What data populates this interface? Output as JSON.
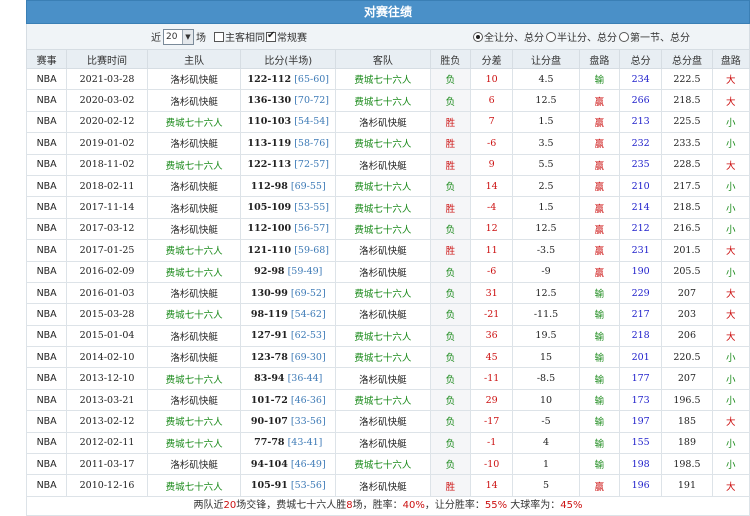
{
  "title": "对赛往绩",
  "filter": {
    "recent_prefix": "近",
    "recent_value": "20",
    "recent_suffix": "场",
    "home_same_label": "主客相同",
    "regular_label": "常规赛",
    "opt1": "全让分、总分",
    "opt2": "半让分、总分",
    "opt3": "第一节、总分"
  },
  "columns": [
    "赛事",
    "比赛时间",
    "主队",
    "比分(半场)",
    "客队",
    "胜负",
    "分差",
    "让分盘",
    "盘路",
    "总分",
    "总分盘",
    "盘路"
  ],
  "rows": [
    {
      "league": "NBA",
      "date": "2021-03-28",
      "home": "洛杉矶快艇",
      "home_g": false,
      "score": "122-112",
      "half": "[65-60]",
      "away": "费城七十六人",
      "away_g": true,
      "wl": "负",
      "diff": "10",
      "handicap": "4.5",
      "hres": "输",
      "total": "234",
      "tline": "222.5",
      "tres": "大"
    },
    {
      "league": "NBA",
      "date": "2020-03-02",
      "home": "洛杉矶快艇",
      "home_g": false,
      "score": "136-130",
      "half": "[70-72]",
      "away": "费城七十六人",
      "away_g": true,
      "wl": "负",
      "diff": "6",
      "handicap": "12.5",
      "hres": "赢",
      "total": "266",
      "tline": "218.5",
      "tres": "大"
    },
    {
      "league": "NBA",
      "date": "2020-02-12",
      "home": "费城七十六人",
      "home_g": true,
      "score": "110-103",
      "half": "[54-54]",
      "away": "洛杉矶快艇",
      "away_g": false,
      "wl": "胜",
      "diff": "7",
      "handicap": "1.5",
      "hres": "赢",
      "total": "213",
      "tline": "225.5",
      "tres": "小"
    },
    {
      "league": "NBA",
      "date": "2019-01-02",
      "home": "洛杉矶快艇",
      "home_g": false,
      "score": "113-119",
      "half": "[58-76]",
      "away": "费城七十六人",
      "away_g": true,
      "wl": "胜",
      "diff": "-6",
      "handicap": "3.5",
      "hres": "赢",
      "total": "232",
      "tline": "233.5",
      "tres": "小"
    },
    {
      "league": "NBA",
      "date": "2018-11-02",
      "home": "费城七十六人",
      "home_g": true,
      "score": "122-113",
      "half": "[72-57]",
      "away": "洛杉矶快艇",
      "away_g": false,
      "wl": "胜",
      "diff": "9",
      "handicap": "5.5",
      "hres": "赢",
      "total": "235",
      "tline": "228.5",
      "tres": "大"
    },
    {
      "league": "NBA",
      "date": "2018-02-11",
      "home": "洛杉矶快艇",
      "home_g": false,
      "score": "112-98",
      "half": "[69-55]",
      "away": "费城七十六人",
      "away_g": true,
      "wl": "负",
      "diff": "14",
      "handicap": "2.5",
      "hres": "赢",
      "total": "210",
      "tline": "217.5",
      "tres": "小"
    },
    {
      "league": "NBA",
      "date": "2017-11-14",
      "home": "洛杉矶快艇",
      "home_g": false,
      "score": "105-109",
      "half": "[53-55]",
      "away": "费城七十六人",
      "away_g": true,
      "wl": "胜",
      "diff": "-4",
      "handicap": "1.5",
      "hres": "赢",
      "total": "214",
      "tline": "218.5",
      "tres": "小"
    },
    {
      "league": "NBA",
      "date": "2017-03-12",
      "home": "洛杉矶快艇",
      "home_g": false,
      "score": "112-100",
      "half": "[56-57]",
      "away": "费城七十六人",
      "away_g": true,
      "wl": "负",
      "diff": "12",
      "handicap": "12.5",
      "hres": "赢",
      "total": "212",
      "tline": "216.5",
      "tres": "小"
    },
    {
      "league": "NBA",
      "date": "2017-01-25",
      "home": "费城七十六人",
      "home_g": true,
      "score": "121-110",
      "half": "[59-68]",
      "away": "洛杉矶快艇",
      "away_g": false,
      "wl": "胜",
      "diff": "11",
      "handicap": "-3.5",
      "hres": "赢",
      "total": "231",
      "tline": "201.5",
      "tres": "大"
    },
    {
      "league": "NBA",
      "date": "2016-02-09",
      "home": "费城七十六人",
      "home_g": true,
      "score": "92-98",
      "half": "[59-49]",
      "away": "洛杉矶快艇",
      "away_g": false,
      "wl": "负",
      "diff": "-6",
      "handicap": "-9",
      "hres": "赢",
      "total": "190",
      "tline": "205.5",
      "tres": "小"
    },
    {
      "league": "NBA",
      "date": "2016-01-03",
      "home": "洛杉矶快艇",
      "home_g": false,
      "score": "130-99",
      "half": "[69-52]",
      "away": "费城七十六人",
      "away_g": true,
      "wl": "负",
      "diff": "31",
      "handicap": "12.5",
      "hres": "输",
      "total": "229",
      "tline": "207",
      "tres": "大"
    },
    {
      "league": "NBA",
      "date": "2015-03-28",
      "home": "费城七十六人",
      "home_g": true,
      "score": "98-119",
      "half": "[54-62]",
      "away": "洛杉矶快艇",
      "away_g": false,
      "wl": "负",
      "diff": "-21",
      "handicap": "-11.5",
      "hres": "输",
      "total": "217",
      "tline": "203",
      "tres": "大"
    },
    {
      "league": "NBA",
      "date": "2015-01-04",
      "home": "洛杉矶快艇",
      "home_g": false,
      "score": "127-91",
      "half": "[62-53]",
      "away": "费城七十六人",
      "away_g": true,
      "wl": "负",
      "diff": "36",
      "handicap": "19.5",
      "hres": "输",
      "total": "218",
      "tline": "206",
      "tres": "大"
    },
    {
      "league": "NBA",
      "date": "2014-02-10",
      "home": "洛杉矶快艇",
      "home_g": false,
      "score": "123-78",
      "half": "[69-30]",
      "away": "费城七十六人",
      "away_g": true,
      "wl": "负",
      "diff": "45",
      "handicap": "15",
      "hres": "输",
      "total": "201",
      "tline": "220.5",
      "tres": "小"
    },
    {
      "league": "NBA",
      "date": "2013-12-10",
      "home": "费城七十六人",
      "home_g": true,
      "score": "83-94",
      "half": "[36-44]",
      "away": "洛杉矶快艇",
      "away_g": false,
      "wl": "负",
      "diff": "-11",
      "handicap": "-8.5",
      "hres": "输",
      "total": "177",
      "tline": "207",
      "tres": "小"
    },
    {
      "league": "NBA",
      "date": "2013-03-21",
      "home": "洛杉矶快艇",
      "home_g": false,
      "score": "101-72",
      "half": "[46-36]",
      "away": "费城七十六人",
      "away_g": true,
      "wl": "负",
      "diff": "29",
      "handicap": "10",
      "hres": "输",
      "total": "173",
      "tline": "196.5",
      "tres": "小"
    },
    {
      "league": "NBA",
      "date": "2013-02-12",
      "home": "费城七十六人",
      "home_g": true,
      "score": "90-107",
      "half": "[33-56]",
      "away": "洛杉矶快艇",
      "away_g": false,
      "wl": "负",
      "diff": "-17",
      "handicap": "-5",
      "hres": "输",
      "total": "197",
      "tline": "185",
      "tres": "大"
    },
    {
      "league": "NBA",
      "date": "2012-02-11",
      "home": "费城七十六人",
      "home_g": true,
      "score": "77-78",
      "half": "[43-41]",
      "away": "洛杉矶快艇",
      "away_g": false,
      "wl": "负",
      "diff": "-1",
      "handicap": "4",
      "hres": "输",
      "total": "155",
      "tline": "189",
      "tres": "小"
    },
    {
      "league": "NBA",
      "date": "2011-03-17",
      "home": "洛杉矶快艇",
      "home_g": false,
      "score": "94-104",
      "half": "[46-49]",
      "away": "费城七十六人",
      "away_g": true,
      "wl": "负",
      "diff": "-10",
      "handicap": "1",
      "hres": "输",
      "total": "198",
      "tline": "198.5",
      "tres": "小"
    },
    {
      "league": "NBA",
      "date": "2010-12-16",
      "home": "费城七十六人",
      "home_g": true,
      "score": "105-91",
      "half": "[53-56]",
      "away": "洛杉矶快艇",
      "away_g": false,
      "wl": "胜",
      "diff": "14",
      "handicap": "5",
      "hres": "赢",
      "total": "196",
      "tline": "191",
      "tres": "大"
    }
  ],
  "summary": {
    "p1": "两队近",
    "n_games": "20",
    "p2": "场交锋，费城七十六人胜",
    "wins": "8",
    "p3": "场，胜率：",
    "win_rate": "40%",
    "p4": "，让分胜率：",
    "ats_rate": "55%",
    "p5": " 大球率为：",
    "over_rate": "45%"
  }
}
